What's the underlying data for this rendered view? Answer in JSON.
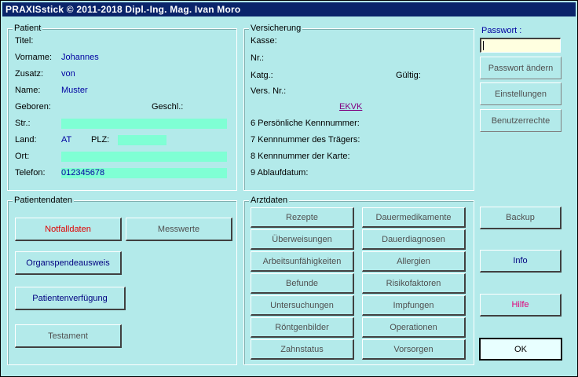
{
  "window": {
    "title": "PRAXISstick © 2011-2018 Dipl.-Ing. Mag. Ivan Moro"
  },
  "patient": {
    "legend": "Patient",
    "titel_label": "Titel:",
    "vorname_label": "Vorname:",
    "vorname": "Johannes",
    "zusatz_label": "Zusatz:",
    "zusatz": "von",
    "name_label": "Name:",
    "name": "Muster",
    "geboren_label": "Geboren:",
    "geschl_label": "Geschl.:",
    "str_label": "Str.:",
    "land_label": "Land:",
    "land": "AT",
    "plz_label": "PLZ:",
    "ort_label": "Ort:",
    "telefon_label": "Telefon:",
    "telefon": "012345678"
  },
  "versicherung": {
    "legend": "Versicherung",
    "kasse_label": "Kasse:",
    "nr_label": "Nr.:",
    "katg_label": "Katg.:",
    "gueltig_label": "Gültig:",
    "versnr_label": "Vers. Nr.:",
    "ekvk_link": "EKVK",
    "line6": "6 Persönliche Kennnummer:",
    "line7": "7 Kennnummer des Trägers:",
    "line8": "8 Kennnummer der Karte:",
    "line9": "9 Ablaufdatum:"
  },
  "passwort": {
    "label": "Passwort :",
    "value": "",
    "change_button": "Passwort ändern",
    "settings_button": "Einstellungen",
    "rights_button": "Benutzerrechte"
  },
  "patientendaten": {
    "legend": "Patientendaten",
    "notfalldaten": "Notfalldaten",
    "messwerte": "Messwerte",
    "organspende": "Organspendeausweis",
    "verfuegung": "Patientenverfügung",
    "testament": "Testament"
  },
  "arztdaten": {
    "legend": "Arztdaten",
    "left": [
      "Rezepte",
      "Überweisungen",
      "Arbeitsunfähigkeiten",
      "Befunde",
      "Untersuchungen",
      "Röntgenbilder",
      "Zahnstatus"
    ],
    "right": [
      "Dauermedikamente",
      "Dauerdiagnosen",
      "Allergien",
      "Risikofaktoren",
      "Impfungen",
      "Operationen",
      "Vorsorgen"
    ]
  },
  "side": {
    "backup": "Backup",
    "info": "Info",
    "hilfe": "Hilfe",
    "ok": "OK"
  },
  "colors": {
    "background": "#b3eaea",
    "field": "#7fffd4",
    "title_bar": "#0a246a",
    "value_text": "#0000a0",
    "notfall_text": "#e00000",
    "hilfe_text": "#e0007a"
  }
}
